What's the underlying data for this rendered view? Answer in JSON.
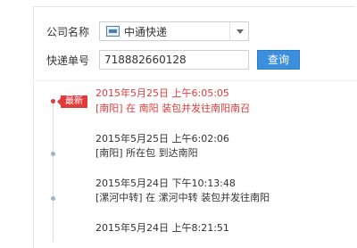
{
  "form": {
    "company_label": "公司名称",
    "company_value": "中通快递",
    "tracking_label": "快递单号",
    "tracking_value": "718882660128",
    "query_button": "查询"
  },
  "timeline": {
    "latest_badge": "最新",
    "entries": [
      {
        "time": "2015年5月25日 上午6:05:05",
        "desc": "[南阳] 在 南阳 装包并发往南阳南召",
        "latest": true
      },
      {
        "time": "2015年5月25日 上午6:02:06",
        "desc": "[南阳] 所在包 到达南阳",
        "latest": false
      },
      {
        "time": "2015年5月24日 下午10:13:48",
        "desc": "[漯河中转] 在 漯河中转 装包并发往南阳",
        "latest": false
      },
      {
        "time": "2015年5月24日 上午8:21:51",
        "desc": "",
        "latest": false
      }
    ]
  },
  "colors": {
    "accent": "#3b8fdc",
    "latest": "#e23b3b",
    "dot": "#9ab4cf"
  }
}
